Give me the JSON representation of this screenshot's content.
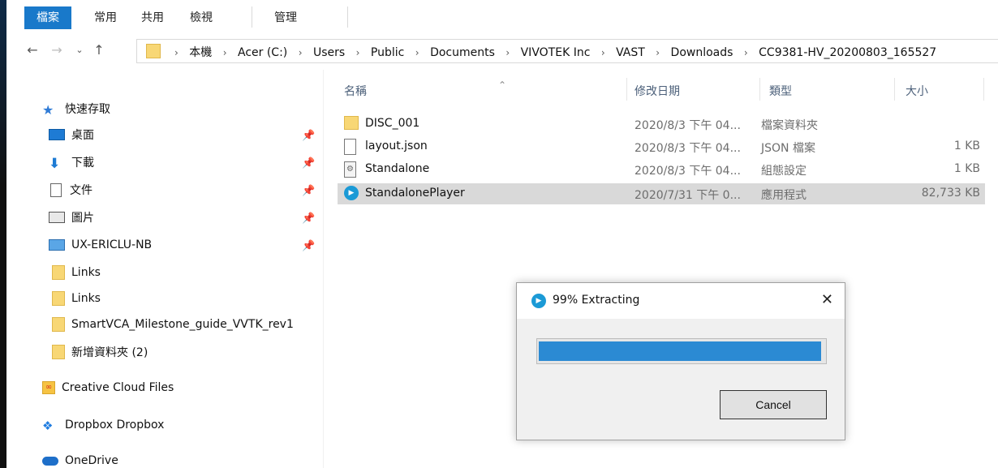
{
  "ribbon": {
    "tabs": [
      "檔案",
      "常用",
      "共用",
      "檢視",
      "管理"
    ],
    "active_index": 0,
    "accent": "#1979ca"
  },
  "address": {
    "crumbs": [
      "本機",
      "Acer (C:)",
      "Users",
      "Public",
      "Documents",
      "VIVOTEK Inc",
      "VAST",
      "Downloads",
      "CC9381-HV_20200803_165527"
    ]
  },
  "nav": {
    "quick_access": "快速存取",
    "items": [
      {
        "label": "桌面",
        "icon": "desktop-icon",
        "pinned": true
      },
      {
        "label": "下載",
        "icon": "download-icon",
        "pinned": true
      },
      {
        "label": "文件",
        "icon": "documents-icon",
        "pinned": true
      },
      {
        "label": "圖片",
        "icon": "pictures-icon",
        "pinned": true
      },
      {
        "label": "UX-ERICLU-NB",
        "icon": "computer-icon",
        "pinned": true
      },
      {
        "label": "Links",
        "icon": "folder-icon",
        "pinned": false
      },
      {
        "label": "Links",
        "icon": "folder-icon",
        "pinned": false
      },
      {
        "label": "SmartVCA_Milestone_guide_VVTK_rev1",
        "icon": "folder-icon",
        "pinned": false
      },
      {
        "label": "新增資料夾 (2)",
        "icon": "folder-icon",
        "pinned": false
      }
    ],
    "creative_cloud": "Creative Cloud Files",
    "dropbox": "Dropbox Dropbox",
    "onedrive": "OneDrive"
  },
  "list": {
    "headers": {
      "name": "名稱",
      "date": "修改日期",
      "type": "類型",
      "size": "大小"
    },
    "rows": [
      {
        "name": "DISC_001",
        "date": "2020/8/3 下午 04...",
        "type": "檔案資料夾",
        "size": "",
        "icon": "folder-icon"
      },
      {
        "name": "layout.json",
        "date": "2020/8/3 下午 04...",
        "type": "JSON 檔案",
        "size": "1 KB",
        "icon": "file-icon"
      },
      {
        "name": "Standalone",
        "date": "2020/8/3 下午 04...",
        "type": "組態設定",
        "size": "1 KB",
        "icon": "settings-file-icon"
      },
      {
        "name": "StandalonePlayer",
        "date": "2020/7/31 下午 0...",
        "type": "應用程式",
        "size": "82,733 KB",
        "icon": "player-app-icon"
      }
    ],
    "selected_index": 3
  },
  "dialog": {
    "title": "99% Extracting",
    "progress": 0.99,
    "cancel_label": "Cancel",
    "progress_color": "#2b8ad3"
  }
}
